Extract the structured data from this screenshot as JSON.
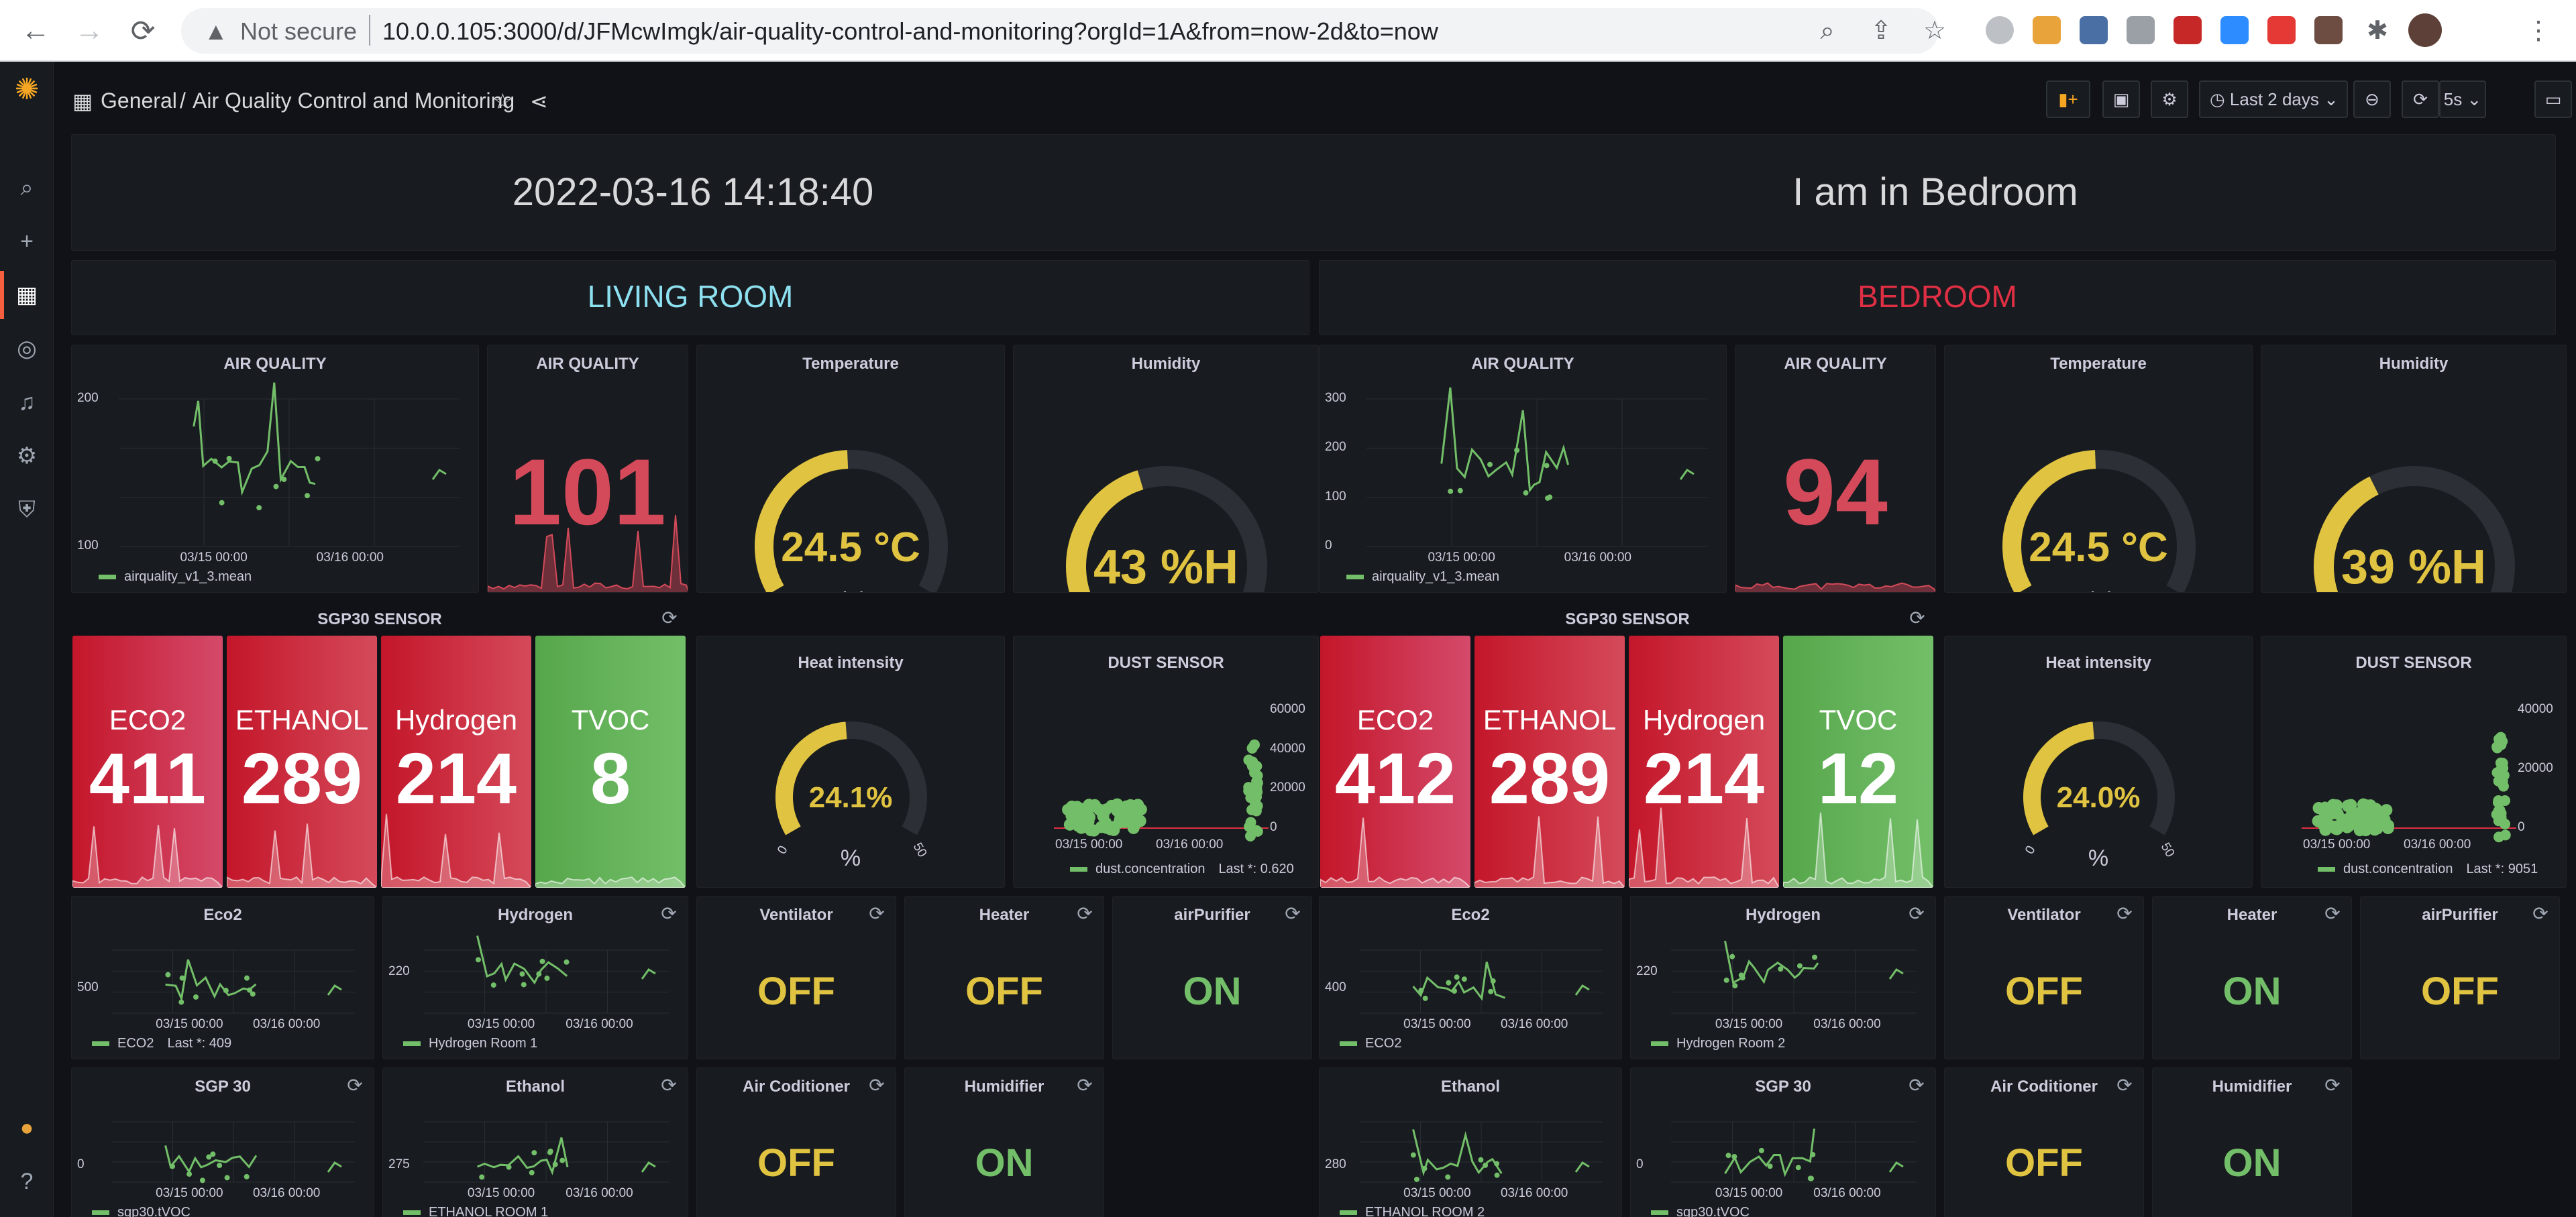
{
  "browser": {
    "security": "Not secure",
    "url": "10.0.0.105:3000/d/JFMcwImgk/air-quality-control-and-monitoring?orgId=1A&from=now-2d&to=now"
  },
  "topbar": {
    "folder": "General",
    "separator": "/",
    "title": "Air Quality Control and Monitoring",
    "time_range": "Last 2 days",
    "refresh_interval": "5s"
  },
  "header": {
    "datetime": "2022-03-16 14:18:40",
    "location": "I am in Bedroom"
  },
  "colors": {
    "green": "#73bf69",
    "yellow": "#e0c341",
    "red": "#d44a5a",
    "teal": "#8de0f0",
    "orange": "#f55f3e"
  },
  "rooms": {
    "living": {
      "title": "LIVING ROOM",
      "aq_graph": {
        "title": "AIR QUALITY",
        "y_ticks": [
          "200",
          "100"
        ],
        "x_ticks": [
          "03/15 00:00",
          "03/16 00:00"
        ],
        "legend": "airquality_v1_3.mean"
      },
      "aq_stat": {
        "title": "AIR QUALITY",
        "value": "101"
      },
      "temperature": {
        "title": "Temperature",
        "value": "24.5 °C",
        "unit": "Celsius",
        "min": "0",
        "max": "50",
        "fraction": 0.49
      },
      "humidity": {
        "title": "Humidity",
        "value": "43 %H",
        "min": "0",
        "max": "100",
        "fraction": 0.43
      },
      "sgp30": {
        "title": "SGP30 SENSOR",
        "stats": [
          {
            "label": "ECO2",
            "value": "411"
          },
          {
            "label": "ETHANOL",
            "value": "289"
          },
          {
            "label": "Hydrogen",
            "value": "214"
          },
          {
            "label": "TVOC",
            "value": "8"
          }
        ]
      },
      "heat": {
        "title": "Heat intensity",
        "value": "24.1%",
        "unit": "%",
        "min": "0",
        "max": "50",
        "fraction": 0.482
      },
      "dust": {
        "title": "DUST SENSOR",
        "y_ticks": [
          "60000",
          "40000",
          "20000",
          "0"
        ],
        "x_ticks": [
          "03/15 00:00",
          "03/16 00:00"
        ],
        "legend": "dust.concentration",
        "last": "Last *: 0.620"
      },
      "eco2": {
        "title": "Eco2",
        "y_ticks": [
          "500"
        ],
        "x_ticks": [
          "03/15 00:00",
          "03/16 00:00"
        ],
        "legend": "ECO2",
        "last": "Last *: 409"
      },
      "hydrogen": {
        "title": "Hydrogen",
        "y_ticks": [
          "220"
        ],
        "x_ticks": [
          "03/15 00:00",
          "03/16 00:00"
        ],
        "legend": "Hydrogen Room 1"
      },
      "ventilator": {
        "title": "Ventilator",
        "state": "OFF"
      },
      "heater": {
        "title": "Heater",
        "state": "OFF"
      },
      "airpurifier": {
        "title": "airPurifier",
        "state": "ON"
      },
      "sgp30_graph": {
        "title": "SGP 30",
        "y_ticks": [
          "0"
        ],
        "x_ticks": [
          "03/15 00:00",
          "03/16 00:00"
        ],
        "legend": "sgp30.tVOC"
      },
      "ethanol": {
        "title": "Ethanol",
        "y_ticks": [
          "275"
        ],
        "x_ticks": [
          "03/15 00:00",
          "03/16 00:00"
        ],
        "legend": "ETHANOL ROOM 1"
      },
      "aircon": {
        "title": "Air Coditioner",
        "state": "OFF"
      },
      "humidifier": {
        "title": "Humidifier",
        "state": "ON"
      }
    },
    "bedroom": {
      "title": "BEDROOM",
      "aq_graph": {
        "title": "AIR QUALITY",
        "y_ticks": [
          "300",
          "200",
          "100",
          "0"
        ],
        "x_ticks": [
          "03/15 00:00",
          "03/16 00:00"
        ],
        "legend": "airquality_v1_3.mean"
      },
      "aq_stat": {
        "title": "AIR QUALITY",
        "value": "94"
      },
      "temperature": {
        "title": "Temperature",
        "value": "24.5 °C",
        "unit": "Celsius",
        "min": "0",
        "max": "50",
        "fraction": 0.49
      },
      "humidity": {
        "title": "Humidity",
        "value": "39 %H",
        "min": "0",
        "max": "100",
        "fraction": 0.39
      },
      "sgp30": {
        "title": "SGP30 SENSOR",
        "stats": [
          {
            "label": "ECO2",
            "value": "412"
          },
          {
            "label": "ETHANOL",
            "value": "289"
          },
          {
            "label": "Hydrogen",
            "value": "214"
          },
          {
            "label": "TVOC",
            "value": "12"
          }
        ]
      },
      "heat": {
        "title": "Heat intensity",
        "value": "24.0%",
        "unit": "%",
        "min": "0",
        "max": "50",
        "fraction": 0.48
      },
      "dust": {
        "title": "DUST SENSOR",
        "y_ticks": [
          "40000",
          "20000",
          "0"
        ],
        "x_ticks": [
          "03/15 00:00",
          "03/16 00:00"
        ],
        "legend": "dust.concentration",
        "last": "Last *: 9051"
      },
      "eco2": {
        "title": "Eco2",
        "y_ticks": [
          "400"
        ],
        "x_ticks": [
          "03/15 00:00",
          "03/16 00:00"
        ],
        "legend": "ECO2"
      },
      "hydrogen": {
        "title": "Hydrogen",
        "y_ticks": [
          "220"
        ],
        "x_ticks": [
          "03/15 00:00",
          "03/16 00:00"
        ],
        "legend": "Hydrogen Room 2"
      },
      "ventilator": {
        "title": "Ventilator",
        "state": "OFF"
      },
      "heater": {
        "title": "Heater",
        "state": "ON"
      },
      "airpurifier": {
        "title": "airPurifier",
        "state": "OFF"
      },
      "ethanol": {
        "title": "Ethanol",
        "y_ticks": [
          "280"
        ],
        "x_ticks": [
          "03/15 00:00",
          "03/16 00:00"
        ],
        "legend": "ETHANOL ROOM 2"
      },
      "sgp30_graph": {
        "title": "SGP 30",
        "y_ticks": [
          "0"
        ],
        "x_ticks": [
          "03/15 00:00",
          "03/16 00:00"
        ],
        "legend": "sgp30.tVOC"
      },
      "aircon": {
        "title": "Air Coditioner",
        "state": "OFF"
      },
      "humidifier": {
        "title": "Humidifier",
        "state": "ON"
      }
    }
  }
}
